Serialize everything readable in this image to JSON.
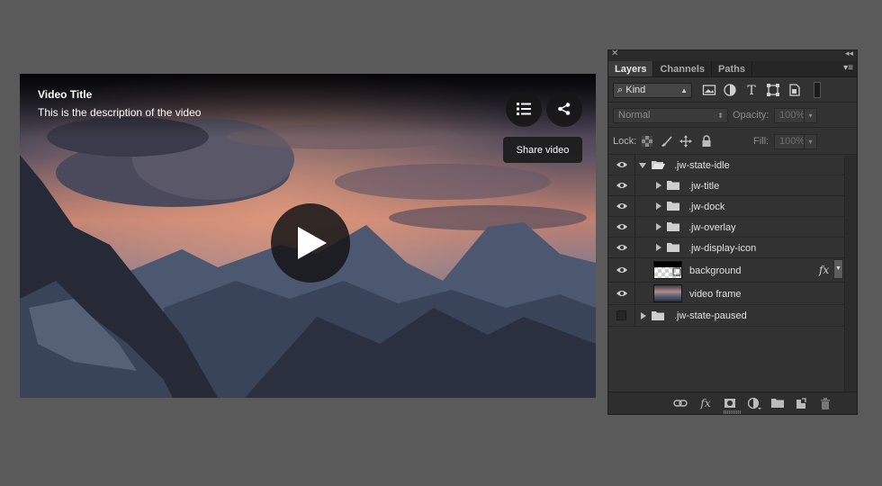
{
  "video": {
    "title": "Video Title",
    "description": "This is the description of the video",
    "tooltip": "Share video",
    "dock_buttons": [
      "playlist-icon",
      "share-icon"
    ],
    "center_button": "play-icon"
  },
  "layers_panel": {
    "tabs": [
      {
        "label": "Layers",
        "active": true
      },
      {
        "label": "Channels",
        "active": false
      },
      {
        "label": "Paths",
        "active": false
      }
    ],
    "filter_kind": "Kind",
    "blend_mode": "Normal",
    "opacity_label": "Opacity:",
    "opacity_value": "100%",
    "lock_label": "Lock:",
    "fill_label": "Fill:",
    "fill_value": "100%",
    "layers": [
      {
        "name": ".jw-state-idle",
        "type": "group",
        "expanded": true,
        "visible": true,
        "indent": 0
      },
      {
        "name": ".jw-title",
        "type": "group",
        "expanded": false,
        "visible": true,
        "indent": 1
      },
      {
        "name": ".jw-dock",
        "type": "group",
        "expanded": false,
        "visible": true,
        "indent": 1
      },
      {
        "name": ".jw-overlay",
        "type": "group",
        "expanded": false,
        "visible": true,
        "indent": 1
      },
      {
        "name": ".jw-display-icon",
        "type": "group",
        "expanded": false,
        "visible": true,
        "indent": 1
      },
      {
        "name": "background",
        "type": "layer",
        "visible": true,
        "indent": 1,
        "has_fx": true
      },
      {
        "name": "video frame",
        "type": "layer",
        "visible": true,
        "indent": 1
      },
      {
        "name": ".jw-state-paused",
        "type": "group",
        "expanded": false,
        "visible": false,
        "indent": 0
      }
    ],
    "footer_icons": [
      "link-icon",
      "fx-icon",
      "mask-icon",
      "adjustment-icon",
      "new-group-icon",
      "new-layer-icon",
      "trash-icon"
    ]
  }
}
